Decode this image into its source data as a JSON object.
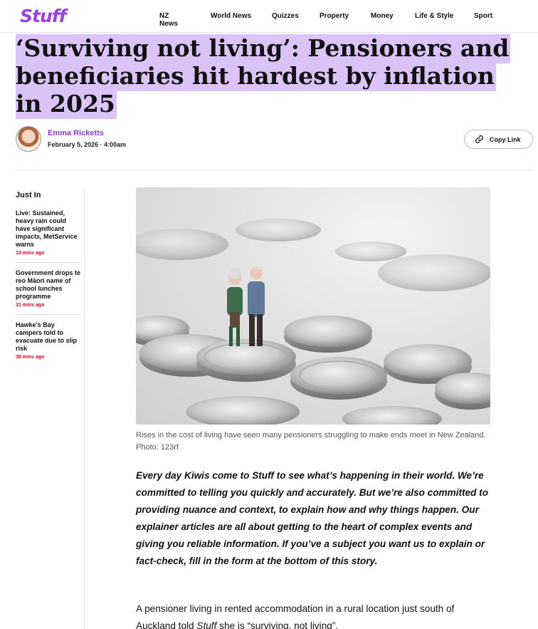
{
  "header": {
    "logo": "Stuff",
    "nav": [
      "NZ News",
      "World News",
      "Quizzes",
      "Property",
      "Money",
      "Life & Style",
      "Sport"
    ]
  },
  "article": {
    "headline": "‘Surviving not living’: Pensioners and beneficiaries hit hardest by inflation in 2025",
    "author": "Emma Ricketts",
    "date": "February 5, 2026 · 4:00am",
    "copy_link_label": "Copy Link",
    "caption": "Rises in the cost of living have seen many pensioners struggling to make ends meet in New Zealand. Photo: 123rf",
    "intro": "Every day Kiwis come to Stuff to see what’s happening in their world. We’re committed to telling you quickly and accurately. But we’re also committed to providing nuance and context, to explain how and why things happen. Our explainer articles are all about getting to the heart of complex events and giving you reliable information. If you’ve a subject you want us to explain or fact-check, fill in the form at the bottom of this story.",
    "para1_before": "A pensioner living in rented accommodation in a rural location just south of Auckland told ",
    "para1_em": "Stuff",
    "para1_after": " she is “surviving, not living”."
  },
  "sidebar": {
    "title": "Just In",
    "items": [
      {
        "title": "Live: Sustained, heavy rain could have significant impacts, MetService warns",
        "ago": "13 mins ago"
      },
      {
        "title": "Government drops te reo Māori name of school lunches programme",
        "ago": "31 mins ago"
      },
      {
        "title": "Hawke’s Bay campers told to evacuate due to slip risk",
        "ago": "38 mins ago"
      }
    ]
  },
  "colors": {
    "brand": "#9b3ff0",
    "headline_highlight": "#dcc3f7",
    "time_ago": "#e8002d"
  }
}
